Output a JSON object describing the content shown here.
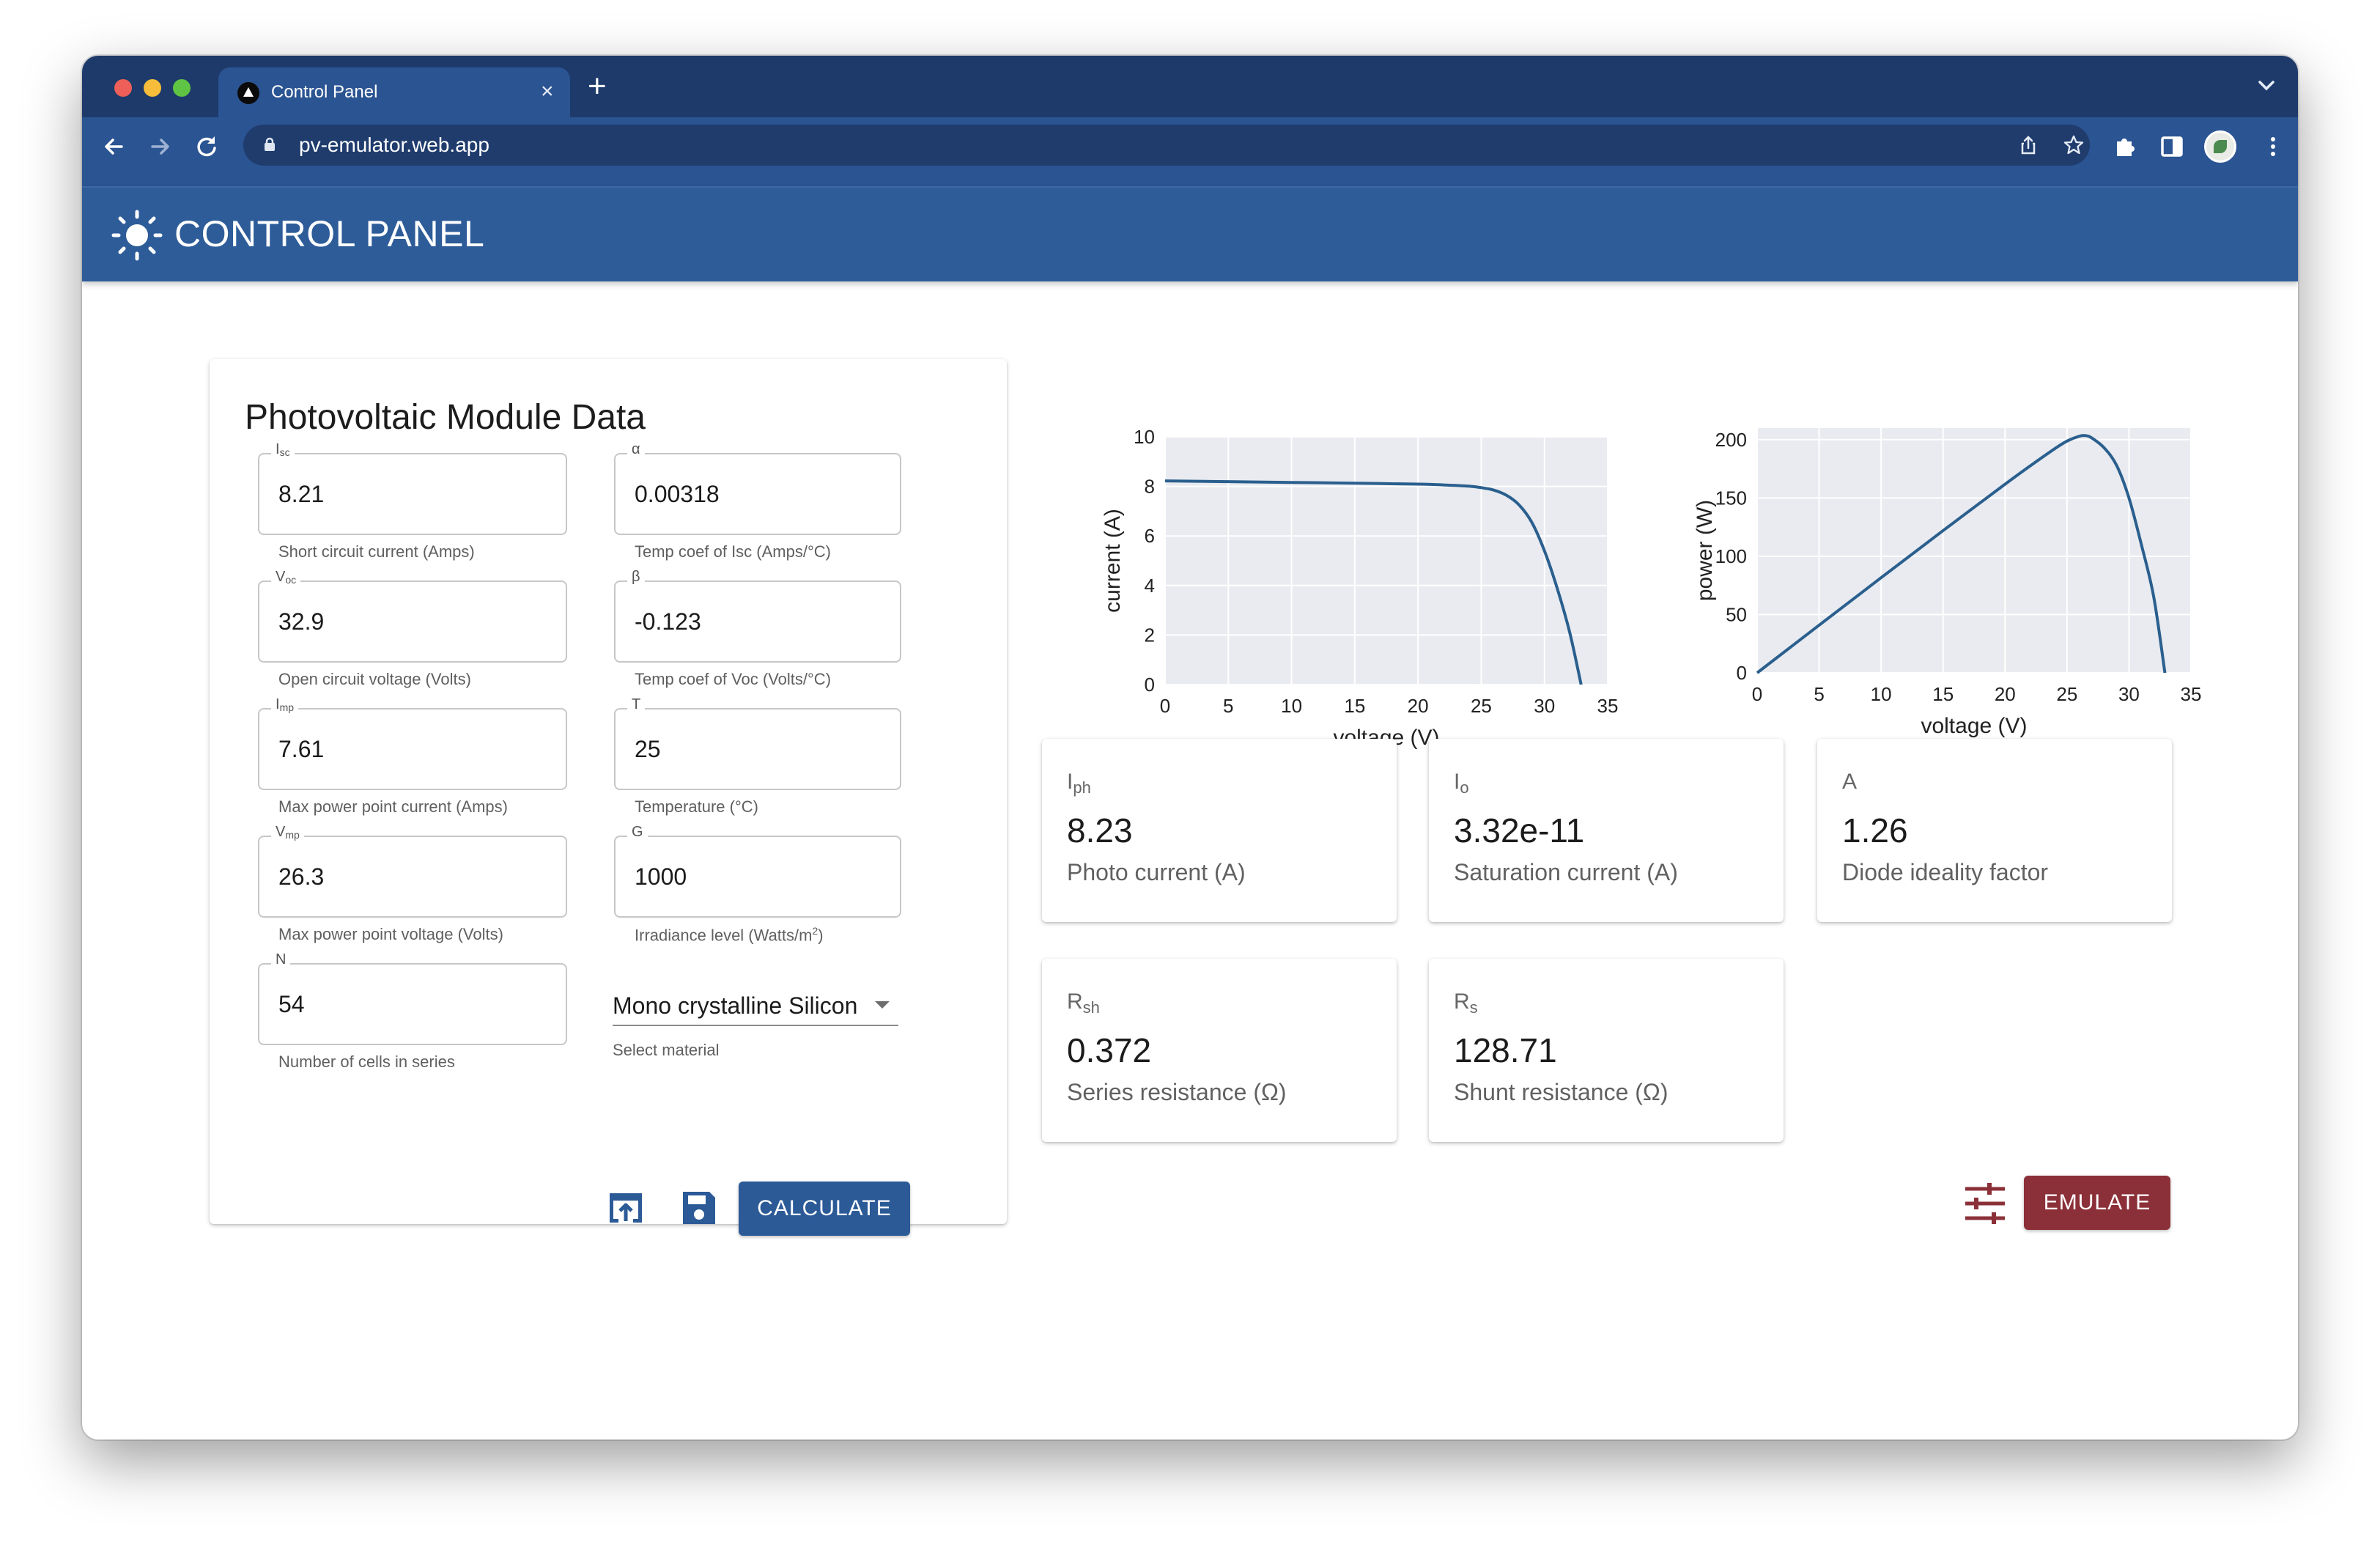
{
  "browser": {
    "tab_title": "Control Panel",
    "tab_close": "×",
    "new_tab": "+",
    "url": "pv-emulator.web.app"
  },
  "header": {
    "title": "CONTROL PANEL"
  },
  "form": {
    "title": "Photovoltaic Module Data",
    "fields": [
      {
        "label_main": "I",
        "label_sub": "sc",
        "value": "8.21",
        "help": "Short circuit current (Amps)"
      },
      {
        "label_main": "α",
        "label_sub": "",
        "value": "0.00318",
        "help": "Temp coef of Isc (Amps/°C)"
      },
      {
        "label_main": "V",
        "label_sub": "oc",
        "value": "32.9",
        "help": "Open circuit voltage (Volts)"
      },
      {
        "label_main": "β",
        "label_sub": "",
        "value": "-0.123",
        "help": "Temp coef of Voc (Volts/°C)"
      },
      {
        "label_main": "I",
        "label_sub": "mp",
        "value": "7.61",
        "help": "Max power point current (Amps)"
      },
      {
        "label_main": "T",
        "label_sub": "",
        "value": "25",
        "help": "Temperature (°C)"
      },
      {
        "label_main": "V",
        "label_sub": "mp",
        "value": "26.3",
        "help": "Max power point voltage (Volts)"
      },
      {
        "label_main": "G",
        "label_sub": "",
        "value": "1000",
        "help_main": "Irradiance level (Watts/m",
        "help_sup": "2",
        "help_end": ")"
      },
      {
        "label_main": "N",
        "label_sub": "",
        "value": "54",
        "help": "Number of cells in series"
      }
    ],
    "material": {
      "selected": "Mono crystalline Silicon",
      "help": "Select material"
    },
    "calculate_label": "CALCULATE"
  },
  "results": [
    {
      "label_main": "I",
      "label_sub": "ph",
      "value": "8.23",
      "desc": "Photo current (A)"
    },
    {
      "label_main": "I",
      "label_sub": "o",
      "value": "3.32e-11",
      "desc": "Saturation current (A)"
    },
    {
      "label_main": "A",
      "label_sub": "",
      "value": "1.26",
      "desc": "Diode ideality factor"
    },
    {
      "label_main": "R",
      "label_sub": "sh",
      "value": "0.372",
      "desc": "Series resistance (Ω)"
    },
    {
      "label_main": "R",
      "label_sub": "s",
      "value": "128.71",
      "desc": "Shunt resistance (Ω)"
    }
  ],
  "emulate_label": "EMULATE",
  "colors": {
    "primary": "#2b5a97",
    "accent": "#8b3038",
    "curve": "#2a5f8e",
    "plot_bg": "#e9ebf0"
  },
  "chart_data": [
    {
      "type": "line",
      "xlabel": "voltage (V)",
      "ylabel": "current (A)",
      "xlim": [
        0,
        35
      ],
      "ylim": [
        0,
        10
      ],
      "xticks": [
        0,
        5,
        10,
        15,
        20,
        25,
        30,
        35
      ],
      "yticks": [
        0,
        2,
        4,
        6,
        8,
        10
      ],
      "grid": true,
      "series": [
        {
          "x": [
            0,
            5,
            10,
            15,
            20,
            22,
            24,
            25,
            26,
            27,
            28,
            29,
            30,
            31,
            32,
            32.9
          ],
          "y": [
            8.22,
            8.19,
            8.16,
            8.13,
            8.09,
            8.06,
            8.01,
            7.95,
            7.85,
            7.64,
            7.25,
            6.55,
            5.4,
            3.9,
            2.1,
            0.0
          ]
        }
      ]
    },
    {
      "type": "line",
      "xlabel": "voltage (V)",
      "ylabel": "power (W)",
      "xlim": [
        0,
        35
      ],
      "ylim": [
        0,
        210
      ],
      "xticks": [
        0,
        5,
        10,
        15,
        20,
        25,
        30,
        35
      ],
      "yticks": [
        0,
        50,
        100,
        150,
        200
      ],
      "grid": true,
      "series": [
        {
          "x": [
            0,
            5,
            10,
            15,
            20,
            22,
            24,
            25,
            26,
            26.5,
            27,
            28,
            29,
            30,
            31,
            32,
            32.9
          ],
          "y": [
            0,
            40.9,
            81.6,
            122,
            161.8,
            177.3,
            192.2,
            198.8,
            203,
            203.5,
            201.5,
            193,
            178,
            150,
            110,
            65,
            0
          ]
        }
      ]
    }
  ]
}
